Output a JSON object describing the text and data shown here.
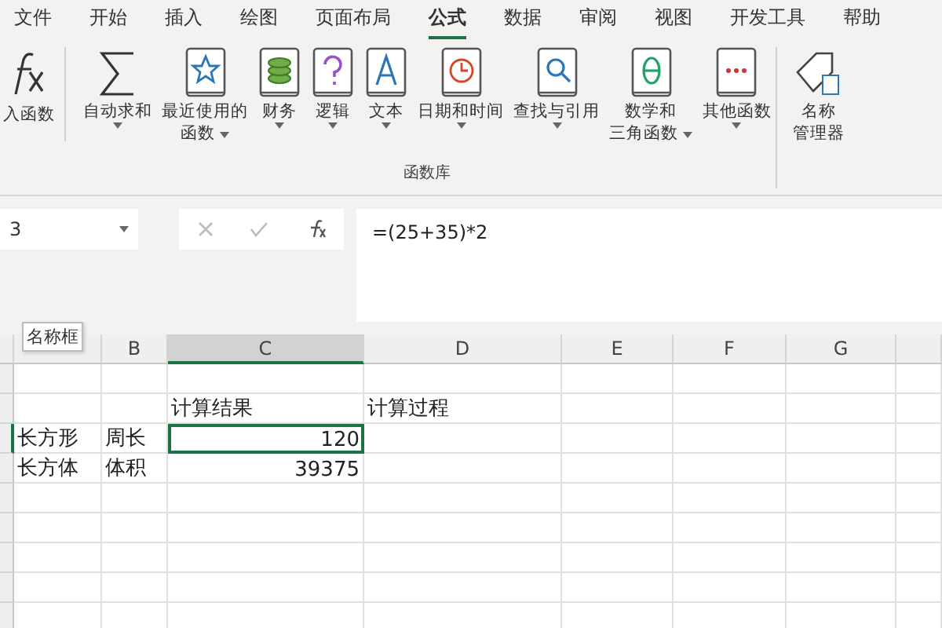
{
  "tabs": [
    {
      "label": "文件",
      "selected": false
    },
    {
      "label": "开始",
      "selected": false
    },
    {
      "label": "插入",
      "selected": false
    },
    {
      "label": "绘图",
      "selected": false
    },
    {
      "label": "页面布局",
      "selected": false
    },
    {
      "label": "公式",
      "selected": true
    },
    {
      "label": "数据",
      "selected": false
    },
    {
      "label": "审阅",
      "selected": false
    },
    {
      "label": "视图",
      "selected": false
    },
    {
      "label": "开发工具",
      "selected": false
    },
    {
      "label": "帮助",
      "selected": false
    }
  ],
  "ribbon": {
    "insert_function": "入函数",
    "group_label": "函数库",
    "name_manager": [
      "名称",
      "管理器"
    ],
    "buttons": [
      {
        "kind": "sum",
        "lines": [
          "自动求和"
        ],
        "dropdown": true
      },
      {
        "kind": "star",
        "lines": [
          "最近使用的",
          "函数"
        ],
        "dropdown": true
      },
      {
        "kind": "finance",
        "lines": [
          "财务"
        ],
        "dropdown": true
      },
      {
        "kind": "logic",
        "lines": [
          "逻辑"
        ],
        "dropdown": true
      },
      {
        "kind": "text",
        "lines": [
          "文本"
        ],
        "dropdown": true
      },
      {
        "kind": "clock",
        "lines": [
          "日期和时间"
        ],
        "dropdown": true
      },
      {
        "kind": "search",
        "lines": [
          "查找与引用"
        ],
        "dropdown": true
      },
      {
        "kind": "theta",
        "lines": [
          "数学和",
          "三角函数"
        ],
        "dropdown": true
      },
      {
        "kind": "more",
        "lines": [
          "其他函数"
        ],
        "dropdown": true
      }
    ]
  },
  "formula_bar": {
    "name_box": "3",
    "formula": "=(25+35)*2",
    "tooltip": "名称框"
  },
  "grid": {
    "columns": [
      {
        "selected": false
      },
      {
        "label": "B",
        "selected": false
      },
      {
        "label": "C",
        "selected": true
      },
      {
        "label": "D",
        "selected": false
      },
      {
        "label": "E",
        "selected": false
      },
      {
        "label": "F",
        "selected": false
      },
      {
        "label": "G",
        "selected": false
      }
    ],
    "rows": [
      {
        "selected": false,
        "cells": [
          null,
          null,
          null,
          null
        ]
      },
      {
        "selected": false,
        "cells": [
          null,
          null,
          {
            "text": "计算结果",
            "kind": "text",
            "selected": false
          },
          {
            "text": "计算过程",
            "kind": "text",
            "selected": false
          }
        ]
      },
      {
        "selected": true,
        "cells": [
          {
            "text": "长方形",
            "kind": "text",
            "selected": false
          },
          {
            "text": "周长",
            "kind": "text",
            "selected": false
          },
          {
            "text": "120",
            "kind": "number",
            "selected": true
          },
          null
        ]
      },
      {
        "selected": false,
        "cells": [
          {
            "text": "长方体",
            "kind": "text",
            "selected": false
          },
          {
            "text": "体积",
            "kind": "text",
            "selected": false
          },
          {
            "text": "39375",
            "kind": "number",
            "selected": false
          },
          null
        ]
      },
      {
        "selected": false,
        "cells": []
      },
      {
        "selected": false,
        "cells": []
      },
      {
        "selected": false,
        "cells": []
      },
      {
        "selected": false,
        "cells": []
      },
      {
        "selected": false,
        "cells": []
      }
    ]
  }
}
